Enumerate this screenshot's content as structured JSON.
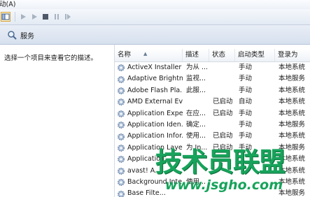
{
  "menu": {
    "item": "动(A)"
  },
  "pane": {
    "title": "服务"
  },
  "left_pane": {
    "description": "选择一个项目来查看它的描述。"
  },
  "columns": {
    "name": "名称",
    "description": "描述",
    "status": "状态",
    "startup_type": "启动类型",
    "log_on_as": "登录为"
  },
  "services": [
    {
      "name": "ActiveX Installer ...",
      "description": "为从 ...",
      "status": "",
      "startup": "手动",
      "logon": "本地系统"
    },
    {
      "name": "Adaptive Brightn...",
      "description": "监视...",
      "status": "",
      "startup": "手动",
      "logon": "本地服务"
    },
    {
      "name": "Adobe Flash Pla...",
      "description": "此服...",
      "status": "",
      "startup": "手动",
      "logon": "本地系统"
    },
    {
      "name": "AMD External Ev...",
      "description": "",
      "status": "已启动",
      "startup": "自动",
      "logon": "本地系统"
    },
    {
      "name": "Application Expe...",
      "description": "在应...",
      "status": "已启动",
      "startup": "手动",
      "logon": "本地系统"
    },
    {
      "name": "Application Iden...",
      "description": "确定...",
      "status": "",
      "startup": "手动",
      "logon": "本地服务"
    },
    {
      "name": "Application Infor...",
      "description": "使用...",
      "status": "已启动",
      "startup": "手动",
      "logon": "本地系统"
    },
    {
      "name": "Application Laye...",
      "description": "为 In...",
      "status": "已启动",
      "startup": "手动",
      "logon": "本地服务"
    },
    {
      "name": "Application...",
      "description": "",
      "status": "",
      "startup": "",
      "logon": "本地系统"
    },
    {
      "name": "avast! A...",
      "description": "",
      "status": "",
      "startup": "",
      "logon": "本地系统"
    },
    {
      "name": "Background Inte...",
      "description": "使用...",
      "status": "",
      "startup": "",
      "logon": "本地系统"
    },
    {
      "name": "Base Filte...",
      "description": "",
      "status": "",
      "startup": "",
      "logon": "本地服务"
    }
  ],
  "watermark": {
    "main": "技术员联盟",
    "url": "www.jsgho.com"
  },
  "colors": {
    "watermark": "#17a35b",
    "header": "#dfe7f2"
  }
}
